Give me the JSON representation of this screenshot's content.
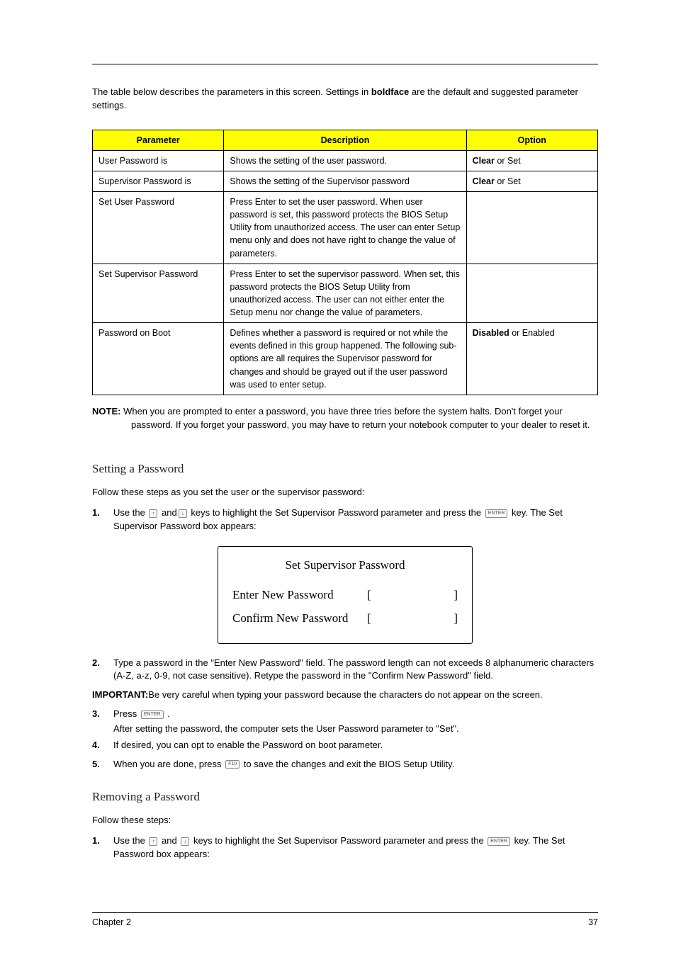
{
  "intro": "The table below describes the parameters in this screen. Settings in ",
  "intro_bold": "boldface",
  "intro_end": " are the default and suggested parameter settings.",
  "table": {
    "headers": [
      "Parameter",
      "Description",
      "Option"
    ],
    "rows": [
      {
        "param": "User Password is",
        "desc": "Shows the setting of the user password.",
        "opt_bold": "Clear",
        "opt_rest": " or Set"
      },
      {
        "param": "Supervisor Password is",
        "desc": "Shows the setting of the Supervisor password",
        "opt_bold": "Clear",
        "opt_rest": " or Set"
      },
      {
        "param": "Set User Password",
        "desc": "Press Enter to set the user password. When user password is set, this password protects the BIOS Setup Utility from unauthorized access. The user can enter Setup menu only and does not have right to change the value of parameters.",
        "opt_bold": "",
        "opt_rest": ""
      },
      {
        "param": "Set Supervisor Password",
        "desc": "Press Enter to set the supervisor password. When set, this password protects the BIOS Setup Utility from unauthorized access. The user can not either enter the Setup menu nor change the value of parameters.",
        "opt_bold": "",
        "opt_rest": ""
      },
      {
        "param": "Password on Boot",
        "desc": "Defines whether a password is required or not while the events defined in this group happened. The following sub-options are all requires the Supervisor password for changes and should be grayed out if the user password was used to enter setup.",
        "opt_bold": "Disabled",
        "opt_rest": " or Enabled"
      }
    ]
  },
  "note": {
    "label": "NOTE: ",
    "text": "When you are prompted to enter a password, you have three tries before the system halts. Don't forget your password. If you forget your password, you may have to return your notebook computer to your dealer to reset it."
  },
  "setting_heading": "Setting a Password",
  "setting_intro": "Follow these steps as you set the user or the supervisor password:",
  "step1": {
    "num": "1.",
    "pre": "Use the ",
    "mid1": " and",
    "mid2": " keys to highlight the Set Supervisor Password parameter and press the ",
    "post": " key. The Set Supervisor Password box appears:"
  },
  "dialog": {
    "title": "Set Supervisor Password",
    "row1": "Enter New Password",
    "row2": "Confirm New Password"
  },
  "step2": {
    "num": "2.",
    "text": "Type a password in the \"Enter New Password\" field. The password length can not exceeds 8 alphanumeric characters (A-Z, a-z, 0-9, not case sensitive). Retype the password in the \"Confirm New Password\" field."
  },
  "important": {
    "label": "IMPORTANT:",
    "text": "Be very careful when typing your password because the characters do not appear on the screen."
  },
  "step3": {
    "num": "3.",
    "pre": "Press  ",
    "post": " .",
    "line2": "After setting the password, the computer sets the User Password parameter to \"Set\"."
  },
  "step4": {
    "num": "4.",
    "text": "If desired, you can opt to enable the Password on boot parameter."
  },
  "step5": {
    "num": "5.",
    "pre": "When you are done, press ",
    "post": " to save the changes and exit the BIOS Setup Utility."
  },
  "removing_heading": "Removing a Password",
  "removing_intro": "Follow these steps:",
  "rstep1": {
    "num": "1.",
    "pre": "Use the ",
    "mid1": " and ",
    "mid2": " keys to highlight the Set Supervisor Password parameter and press the ",
    "post": " key. The Set Password box appears:"
  },
  "footer": {
    "left": "Chapter 2",
    "right": "37"
  },
  "keys": {
    "up": "↑",
    "down": "↓",
    "enter": "ENTER",
    "fkey": "F10"
  }
}
